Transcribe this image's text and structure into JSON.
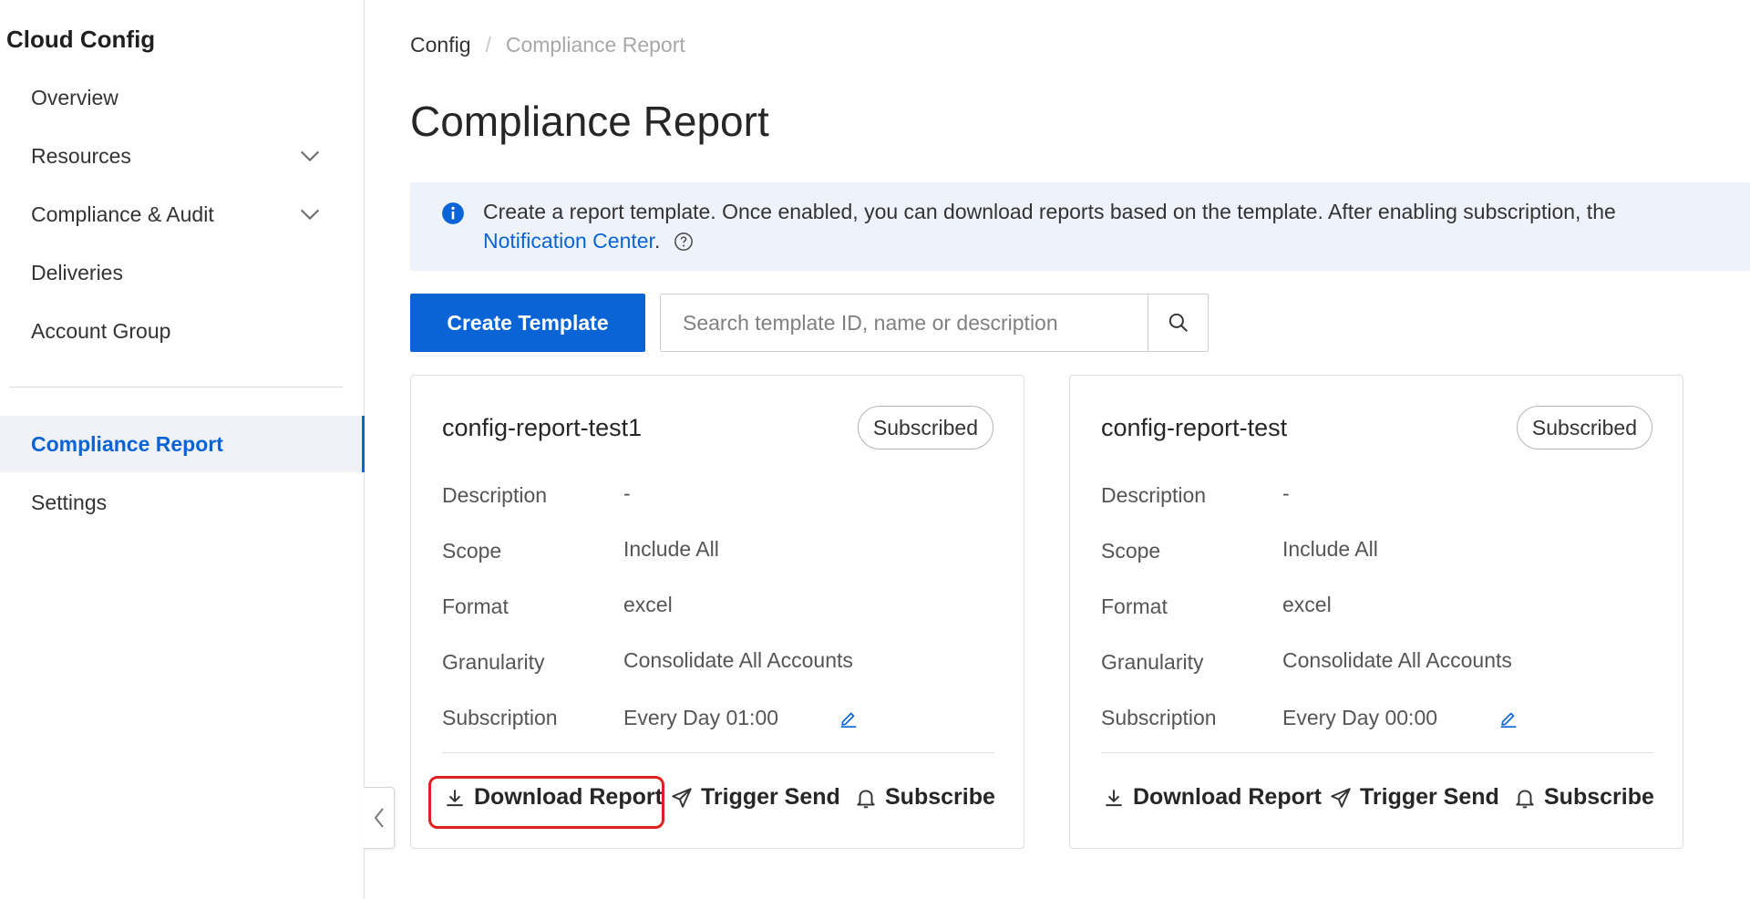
{
  "app": {
    "title": "Cloud Config"
  },
  "sidebar": {
    "items": [
      {
        "label": "Overview"
      },
      {
        "label": "Resources",
        "expandable": true
      },
      {
        "label": "Compliance & Audit",
        "expandable": true
      },
      {
        "label": "Deliveries"
      },
      {
        "label": "Account Group"
      },
      {
        "label": "Compliance Report",
        "active": true
      },
      {
        "label": "Settings"
      }
    ]
  },
  "breadcrumb": {
    "root": "Config",
    "separator": "/",
    "current": "Compliance Report"
  },
  "page": {
    "title": "Compliance Report"
  },
  "banner": {
    "icon": "info-icon",
    "text": "Create a report template. Once enabled, you can download reports based on the template. After enabling subscription, the",
    "link": "Notification Center",
    "after_link": "."
  },
  "toolbar": {
    "create_label": "Create Template",
    "search_placeholder": "Search template ID, name or description"
  },
  "field_labels": {
    "description": "Description",
    "scope": "Scope",
    "format": "Format",
    "granularity": "Granularity",
    "subscription": "Subscription"
  },
  "actions": {
    "download": "Download Report",
    "trigger": "Trigger Send",
    "subscribe": "Subscribe"
  },
  "cards": [
    {
      "name": "config-report-test1",
      "status": "Subscribed",
      "description": "-",
      "scope": "Include All",
      "format": "excel",
      "granularity": "Consolidate All Accounts",
      "subscription": "Every Day 01:00"
    },
    {
      "name": "config-report-test",
      "status": "Subscribed",
      "description": "-",
      "scope": "Include All",
      "format": "excel",
      "granularity": "Consolidate All Accounts",
      "subscription": "Every Day 00:00"
    }
  ],
  "colors": {
    "accent": "#0a64d6",
    "highlight": "#e02020",
    "banner_bg": "#edf2fb"
  }
}
